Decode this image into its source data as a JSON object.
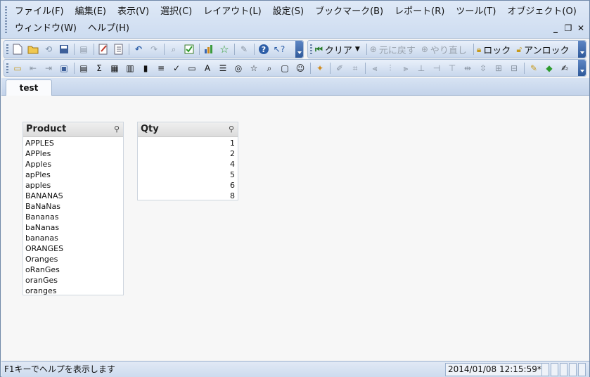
{
  "menu": {
    "row1": [
      "ファイル(F)",
      "編集(E)",
      "表示(V)",
      "選択(C)",
      "レイアウト(L)",
      "設定(S)",
      "ブックマーク(B)",
      "レポート(R)",
      "ツール(T)",
      "オブジェクト(O)"
    ],
    "row2": [
      "ウィンドウ(W)",
      "ヘルプ(H)"
    ]
  },
  "toolbar": {
    "clear_label": "クリア",
    "back_label": "元に戻す",
    "redo_label": "やり直し",
    "lock_label": "ロック",
    "unlock_label": "アンロック"
  },
  "sheet_tab": "test",
  "listboxes": {
    "product": {
      "title": "Product",
      "items": [
        "APPLES",
        "APPles",
        "Apples",
        "apPles",
        "apples",
        "BANANAS",
        "BaNaNas",
        "Bananas",
        "baNanas",
        "bananas",
        "ORANGES",
        "Oranges",
        "oRanGes",
        "oranGes",
        "oranges"
      ]
    },
    "qty": {
      "title": "Qty",
      "items": [
        "1",
        "2",
        "4",
        "5",
        "6",
        "8"
      ]
    }
  },
  "status": {
    "help_text": "F1キーでヘルプを表示します",
    "timestamp": "2014/01/08 12:15:59*"
  },
  "colors": {
    "menubar": "#dfe9f7",
    "accent": "#2f5a9a"
  }
}
